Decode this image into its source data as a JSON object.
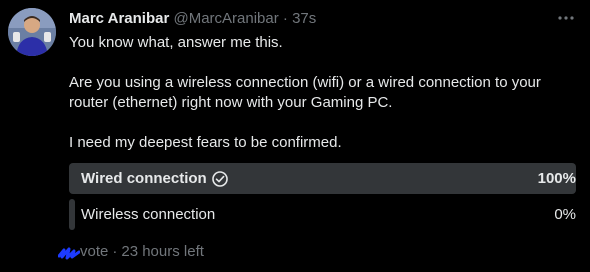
{
  "tweet": {
    "author_name": "Marc Aranibar",
    "handle": "@MarcAranibar",
    "separator": "·",
    "time": "37s",
    "paragraphs": [
      "You know what, answer me this.",
      "Are you using a wireless connection (wifi) or a wired connection to your router (ethernet) right now with your Gaming PC.",
      "I need my deepest fears to be confirmed."
    ]
  },
  "poll": {
    "options": [
      {
        "label": "Wired connection",
        "percent_text": "100%",
        "percent": 100,
        "winner": true
      },
      {
        "label": "Wireless connection",
        "percent_text": "0%",
        "percent": 0,
        "winner": false
      }
    ],
    "footer": {
      "votes": "vote",
      "separator": "·",
      "time_left": "23 hours left"
    }
  },
  "colors": {
    "background": "#000000",
    "text_primary": "#e7e9ea",
    "text_secondary": "#71767b",
    "poll_bar": "#333639",
    "scribble": "#1d3bff"
  },
  "icons": {
    "more": "more-horizontal-icon",
    "winner_check": "check-circle-icon",
    "avatar": "avatar"
  }
}
